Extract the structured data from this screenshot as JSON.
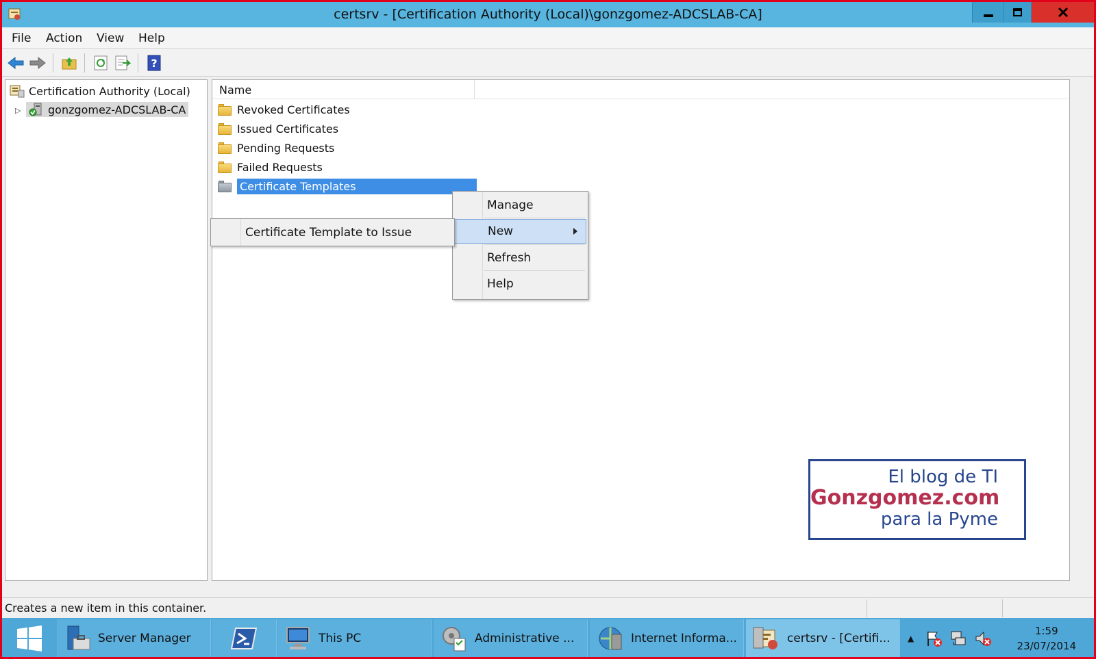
{
  "window": {
    "title": "certsrv - [Certification Authority (Local)\\gonzgomez-ADCSLAB-CA]",
    "min_icon": "minimize-icon",
    "max_icon": "restore-icon",
    "close_icon": "close-icon"
  },
  "menubar": {
    "items": [
      "File",
      "Action",
      "View",
      "Help"
    ]
  },
  "toolbar": {
    "icons": [
      "back-arrow-icon",
      "forward-arrow-icon",
      "up-folder-icon",
      "refresh-icon",
      "export-list-icon",
      "help-icon"
    ]
  },
  "tree": {
    "root": "Certification Authority (Local)",
    "child": "gonzgomez-ADCSLAB-CA"
  },
  "list": {
    "column_header": "Name",
    "items": [
      "Revoked Certificates",
      "Issued Certificates",
      "Pending Requests",
      "Failed Requests",
      "Certificate Templates"
    ],
    "selected_index": 4
  },
  "context_menu": {
    "items": [
      "Manage",
      "New",
      "Refresh",
      "Help"
    ],
    "highlighted": "New"
  },
  "submenu": {
    "items": [
      "Certificate Template to Issue"
    ]
  },
  "watermark": {
    "line1": "El blog de TI",
    "line2": "Gonzgomez.com",
    "line3": "para la Pyme"
  },
  "statusbar": {
    "text": "Creates a new item in this container."
  },
  "taskbar": {
    "items": [
      {
        "label": "Server Manager",
        "icon": "server-manager-icon"
      },
      {
        "label": "",
        "icon": "powershell-icon"
      },
      {
        "label": "This PC",
        "icon": "computer-icon"
      },
      {
        "label": "Administrative ...",
        "icon": "admin-tools-icon"
      },
      {
        "label": "Internet Informa...",
        "icon": "iis-icon"
      },
      {
        "label": "certsrv - [Certifi...",
        "icon": "certsrv-icon"
      }
    ],
    "clock_time": "1:59",
    "clock_date": "23/07/2014"
  },
  "colors": {
    "titlebar": "#57b5df",
    "selection": "#3e8ee6",
    "frame_border": "#e3001b",
    "watermark_blue": "#27468e",
    "watermark_red": "#b5304e"
  }
}
